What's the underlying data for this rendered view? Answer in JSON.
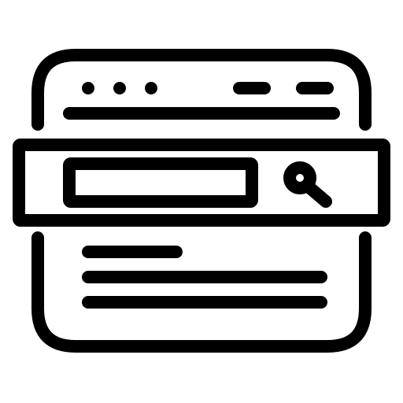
{
  "icon": {
    "name": "browser-search-icon",
    "stroke_color": "#000000",
    "background_color": "#ffffff",
    "window_dots_count": 3,
    "window_bars_count": 2,
    "content_lines_count": 3
  }
}
